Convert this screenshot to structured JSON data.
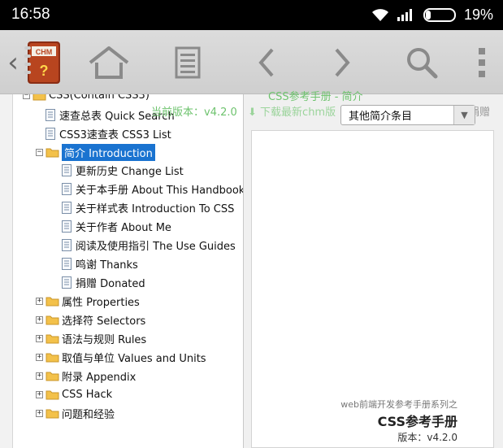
{
  "status_bar": {
    "time": "16:58",
    "battery_pct": "19%",
    "battery_level": 0.19
  },
  "toolbar": {
    "back_chevron": "‹",
    "chm_label": "CHM",
    "chm_question": "?",
    "buttons": [
      "home",
      "list",
      "back",
      "forward",
      "search",
      "menu"
    ]
  },
  "tree": {
    "partial_top": "CSS(Contain CSS3)",
    "items": [
      {
        "label": "速查总表 Quick Search"
      },
      {
        "label": "CSS3速查表 CSS3 List"
      },
      {
        "label": "简介 Introduction",
        "selected": true
      },
      {
        "label": "更新历史 Change List"
      },
      {
        "label": "关于本手册 About This Handbook"
      },
      {
        "label": "关于样式表 Introduction To CSS"
      },
      {
        "label": "关于作者 About Me"
      },
      {
        "label": "阅读及使用指引 The Use Guides"
      },
      {
        "label": "鸣谢 Thanks"
      },
      {
        "label": "捐赠 Donated"
      },
      {
        "label": "属性 Properties"
      },
      {
        "label": "选择符 Selectors"
      },
      {
        "label": "语法与规则 Rules"
      },
      {
        "label": "取值与单位 Values and Units"
      },
      {
        "label": "附录 Appendix"
      },
      {
        "label": "CSS Hack"
      },
      {
        "label": "问题和经验"
      }
    ]
  },
  "content": {
    "current_version": "当前版本：v4.2.0",
    "download_text": "下载最新chm版",
    "partial_header": "CSS参考手册 - 简介",
    "about_text": "关于",
    "donate_text": "捐赠",
    "select_value": "其他简介条目",
    "series_text": "web前端开发参考手册系列之",
    "brand_title": "CSS参考手册",
    "version_text": "版本：v4.2.0"
  },
  "colors": {
    "selected": "#1a73d0",
    "green_link": "#6ec36e",
    "folder": "#f3c14a"
  }
}
